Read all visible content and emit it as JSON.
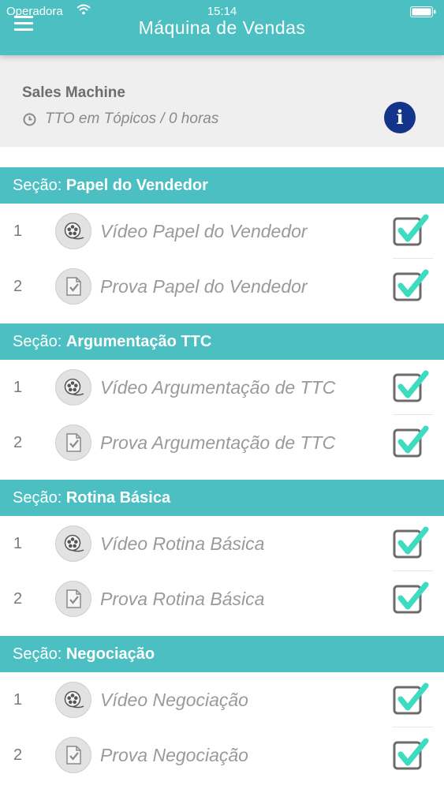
{
  "status_bar": {
    "carrier": "Operadora",
    "time": "15:14"
  },
  "header": {
    "title": "Máquina de Vendas"
  },
  "course": {
    "title": "Sales Machine",
    "duration": "TTO em Tópicos / 0 horas"
  },
  "colors": {
    "accent": "#4bbfc1",
    "info": "#13348a",
    "check": "#3ddbc0"
  },
  "section_prefix": "Seção:",
  "sections": [
    {
      "name": "Papel do Vendedor",
      "items": [
        {
          "number": "1",
          "label": "Vídeo Papel do Vendedor",
          "type": "video-icon",
          "completed": true
        },
        {
          "number": "2",
          "label": "Prova Papel do Vendedor",
          "type": "quiz-icon",
          "completed": true
        }
      ]
    },
    {
      "name": "Argumentação TTC",
      "items": [
        {
          "number": "1",
          "label": "Vídeo Argumentação de TTC",
          "type": "video-icon",
          "completed": true
        },
        {
          "number": "2",
          "label": "Prova Argumentação de TTC",
          "type": "quiz-icon",
          "completed": true
        }
      ]
    },
    {
      "name": "Rotina Básica",
      "items": [
        {
          "number": "1",
          "label": "Vídeo Rotina Básica",
          "type": "video-icon",
          "completed": true
        },
        {
          "number": "2",
          "label": "Prova Rotina Básica",
          "type": "quiz-icon",
          "completed": true
        }
      ]
    },
    {
      "name": "Negociação",
      "items": [
        {
          "number": "1",
          "label": "Vídeo Negociação",
          "type": "video-icon",
          "completed": true
        },
        {
          "number": "2",
          "label": "Prova Negociação",
          "type": "quiz-icon",
          "completed": true
        }
      ]
    }
  ]
}
